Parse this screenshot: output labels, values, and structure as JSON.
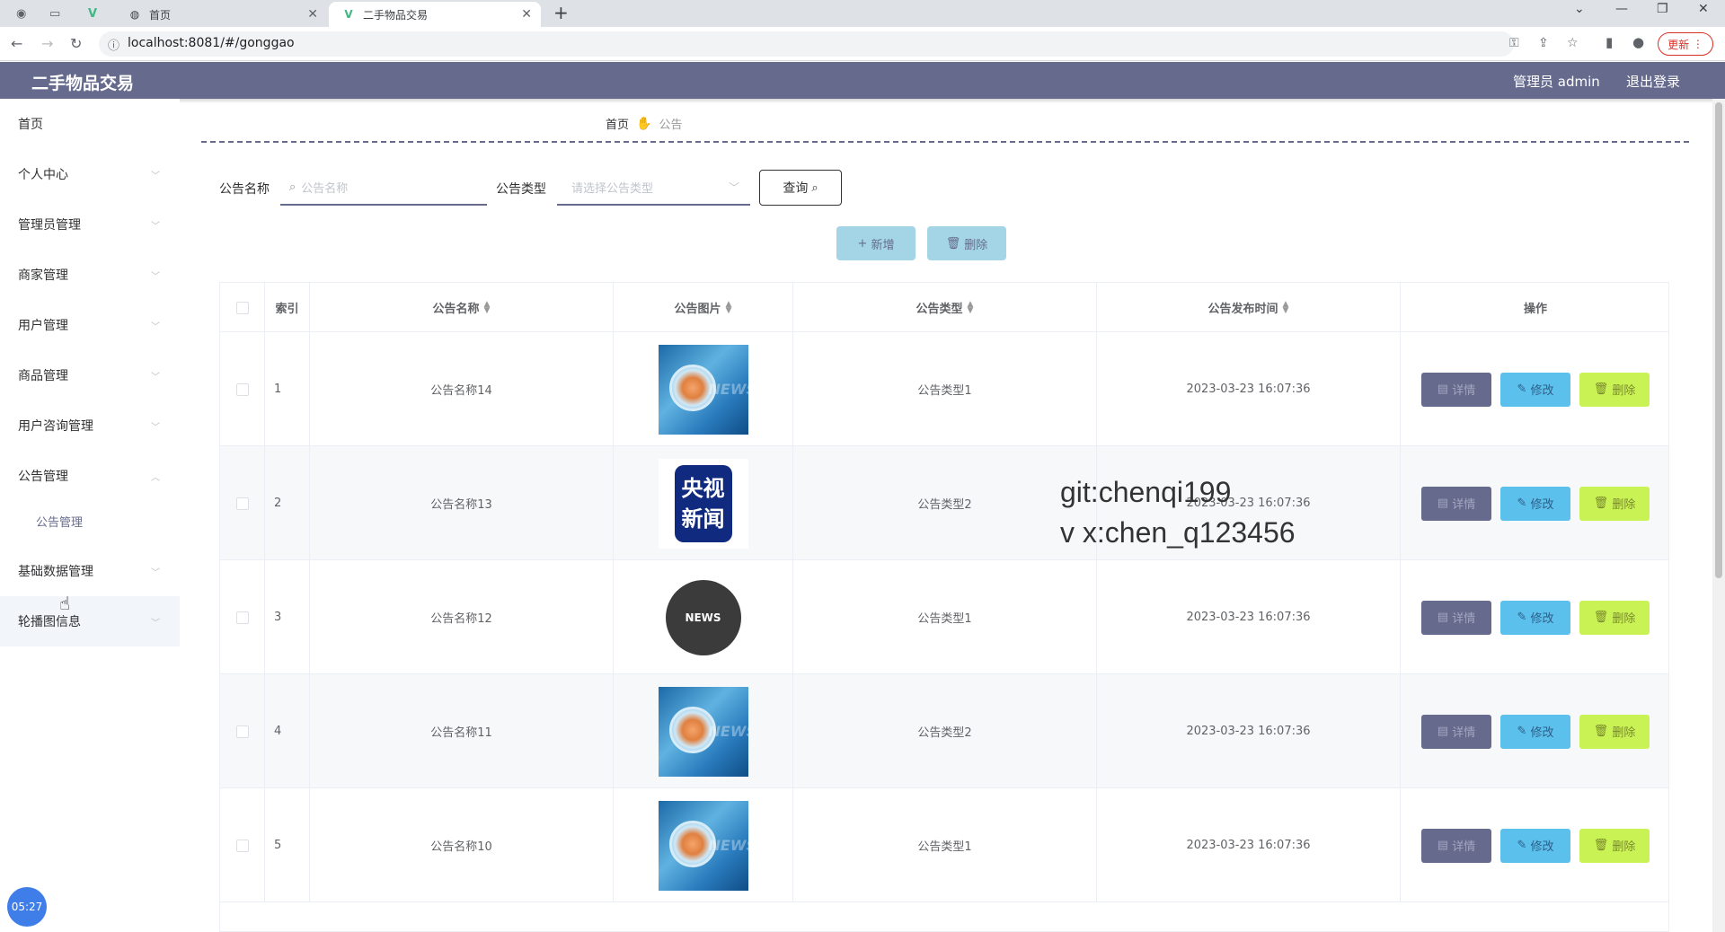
{
  "browser": {
    "tabs": [
      {
        "title": "首页"
      },
      {
        "title": "二手物品交易"
      }
    ],
    "url": "localhost:8081/#/gonggao",
    "update_label": "更新"
  },
  "header": {
    "brand": "二手物品交易",
    "user_label": "管理员 admin",
    "logout_label": "退出登录"
  },
  "sidebar": {
    "items": [
      {
        "label": "首页"
      },
      {
        "label": "个人中心"
      },
      {
        "label": "管理员管理"
      },
      {
        "label": "商家管理"
      },
      {
        "label": "用户管理"
      },
      {
        "label": "商品管理"
      },
      {
        "label": "用户咨询管理"
      },
      {
        "label": "公告管理"
      },
      {
        "label": "公告管理"
      },
      {
        "label": "基础数据管理"
      },
      {
        "label": "轮播图信息"
      }
    ]
  },
  "breadcrumb": {
    "home": "首页",
    "current": "公告"
  },
  "filters": {
    "name_label": "公告名称",
    "name_placeholder": "公告名称",
    "type_label": "公告类型",
    "type_placeholder": "请选择公告类型",
    "query_label": "查询"
  },
  "actions": {
    "add_label": "新增",
    "delete_label": "删除"
  },
  "table": {
    "columns": [
      "索引",
      "公告名称",
      "公告图片",
      "公告类型",
      "公告发布时间",
      "操作"
    ],
    "op_labels": {
      "detail": "详情",
      "edit": "修改",
      "delete": "删除"
    },
    "rows": [
      {
        "index": "1",
        "name": "公告名称14",
        "image": "news",
        "type": "公告类型1",
        "time": "2023-03-23 16:07:36"
      },
      {
        "index": "2",
        "name": "公告名称13",
        "image": "cctv",
        "type": "公告类型2",
        "time": "2023-03-23 16:07:36"
      },
      {
        "index": "3",
        "name": "公告名称12",
        "image": "globe",
        "type": "公告类型1",
        "time": "2023-03-23 16:07:36"
      },
      {
        "index": "4",
        "name": "公告名称11",
        "image": "news",
        "type": "公告类型2",
        "time": "2023-03-23 16:07:36"
      },
      {
        "index": "5",
        "name": "公告名称10",
        "image": "news",
        "type": "公告类型1",
        "time": "2023-03-23 16:07:36"
      }
    ]
  },
  "images": {
    "cctv_line1": "央视",
    "cctv_line2": "新闻",
    "news_text": "NEWS"
  },
  "watermark": {
    "line1": "git:chenqi199",
    "line2": "v x:chen_q123456"
  },
  "timer": "05:27",
  "colors": {
    "primary": "#666b8e",
    "edit": "#5bc0eb",
    "delete": "#c9f254",
    "add": "#a3d5e6"
  }
}
